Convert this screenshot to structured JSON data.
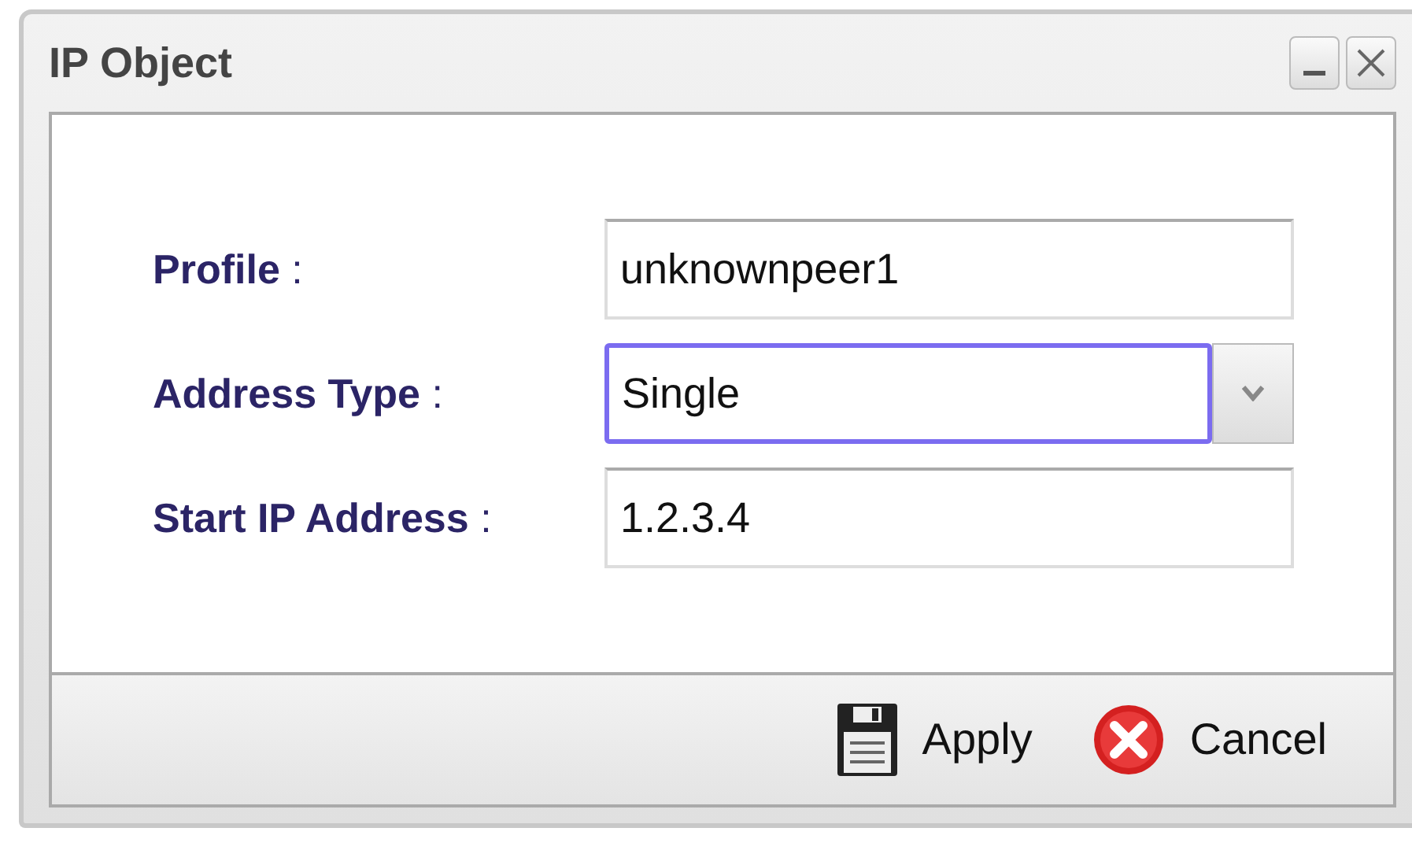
{
  "window": {
    "title": "IP Object"
  },
  "fields": [
    {
      "label": "Profile",
      "separator": ":",
      "kind": "text",
      "value": "unknownpeer1",
      "focused": false
    },
    {
      "label": "Address Type",
      "separator": ":",
      "kind": "select",
      "value": "Single",
      "focused": true
    },
    {
      "label": "Start IP Address",
      "separator": ":",
      "kind": "text",
      "value": "1.2.3.4",
      "focused": false
    }
  ],
  "buttons": [
    {
      "label": "Apply",
      "kind": "save"
    },
    {
      "label": "Cancel",
      "kind": "cancel"
    }
  ]
}
